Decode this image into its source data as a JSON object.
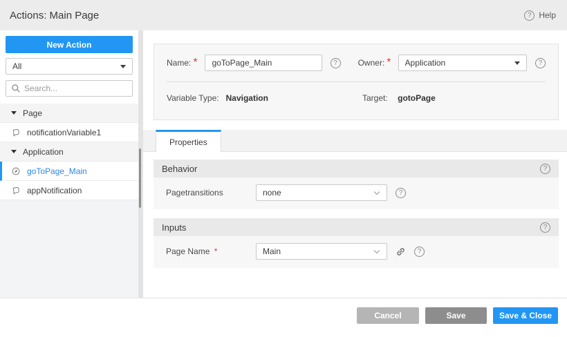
{
  "header": {
    "title": "Actions: Main Page",
    "help_label": "Help"
  },
  "icons": {
    "question_glyph": "?"
  },
  "sidebar": {
    "new_action_label": "New Action",
    "filter_value": "All",
    "search_placeholder": "Search...",
    "tree": [
      {
        "type": "group",
        "label": "Page"
      },
      {
        "type": "item",
        "label": "notificationVariable1",
        "icon": "notification"
      },
      {
        "type": "group",
        "label": "Application"
      },
      {
        "type": "item",
        "label": "goToPage_Main",
        "icon": "navigation",
        "selected": true
      },
      {
        "type": "item",
        "label": "appNotification",
        "icon": "notification"
      }
    ]
  },
  "form": {
    "name_label": "Name:",
    "name_value": "goToPage_Main",
    "owner_label": "Owner:",
    "owner_value": "Application",
    "variable_type_label": "Variable Type:",
    "variable_type_value": "Navigation",
    "target_label": "Target:",
    "target_value": "gotoPage",
    "required_marker": "*"
  },
  "tabs": [
    {
      "label": "Properties",
      "active": true
    }
  ],
  "sections": {
    "behavior": {
      "title": "Behavior",
      "fields": [
        {
          "label": "Pagetransitions",
          "value": "none"
        }
      ]
    },
    "inputs": {
      "title": "Inputs",
      "fields": [
        {
          "label": "Page Name",
          "required": "*",
          "value": "Main"
        }
      ]
    }
  },
  "footer": {
    "cancel_label": "Cancel",
    "save_label": "Save",
    "save_close_label": "Save & Close"
  },
  "colors": {
    "accent_blue": "#2196f3",
    "selected_text": "#2e87e8",
    "cancel_gray": "#b5b5b5",
    "save_gray": "#8d8d8d",
    "required_red": "#e53935",
    "header_bg": "#ececec",
    "panel_bg": "#f7f7f8",
    "section_header_bg": "#e9e9ea"
  }
}
